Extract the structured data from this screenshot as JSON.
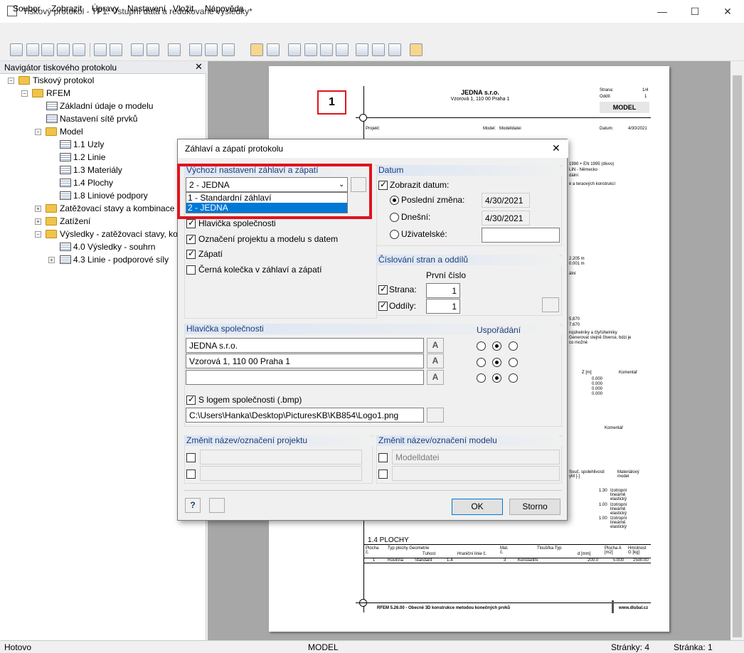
{
  "window": {
    "title": "Tiskový protokol - TP1: Vstupní data a redukované výsledky*"
  },
  "menu": [
    "Soubor",
    "Zobrazit",
    "Úpravy",
    "Nastavení",
    "Vložit",
    "Nápověda"
  ],
  "navigator": {
    "title": "Navigátor tiskového protokolu",
    "items": [
      "Tiskový protokol",
      "RFEM",
      "Základní údaje o modelu",
      "Nastavení sítě prvků",
      "Model",
      "1.1 Uzly",
      "1.2 Linie",
      "1.3 Materiály",
      "1.4 Plochy",
      "1.8 Liniové podpory",
      "Zatěžovací stavy a kombinace",
      "Zatížení",
      "Výsledky - zatěžovací stavy, kom",
      "4.0 Výsledky - souhrn",
      "4.3 Linie - podporové síly"
    ]
  },
  "page": {
    "number": "1",
    "company": "JEDNA s.r.o.",
    "address": "Vzorová 1, 110 00 Praha 1",
    "strana_label": "Strana:",
    "strana_val": "1/4",
    "oddil_label": "Oddíl:",
    "oddil_val": "1",
    "model_box": "MODEL",
    "projekt_label": "Projekt:",
    "model_label": "Model:",
    "model_val": "Modelldatei",
    "datum_label": "Datum:",
    "datum_val": "4/30/2021",
    "section": "1.4 PLOCHY",
    "footer_left": "RFEM 5.26.00 - Obecné 3D konstrukce metodou konečných prvků",
    "footer_right": "www.dlubal.cz",
    "snippets": [
      "1990 + EN 1995 (dlvvo)",
      "LIN - Německo",
      "dální",
      "é a teraových konstrukcí",
      "2.205 m",
      "0.001 m",
      "ální",
      "5.870",
      "7.670",
      "rojúhelníky a čtyřúhelníky",
      "Generovat stejně čtverce, bdzi je",
      "co možné",
      "Z [m]",
      "Komentář",
      "0.000",
      "0.000",
      "0.000",
      "0.000",
      "Komentář",
      "Souč. spolehlivosti γM [-]",
      "Materiálový model",
      "1.30",
      "Izotropní lineárně elastický",
      "1.00",
      "Izotropní lineárně elastický",
      "1.00",
      "Izotropní lineárně elastický"
    ],
    "table": {
      "h1": [
        "Plocha č.",
        "Typ plochy Geometrie",
        "Tuhost",
        "Hraniční linie č.",
        "Mat. č.",
        "Tloušťka Typ",
        "d [mm]",
        "Plocha A [m2]",
        "Hmotnost G [kg]"
      ],
      "row": [
        "1",
        "Rovinná",
        "Standard",
        "1-4",
        "3",
        "Konstantní",
        "200.0",
        "5.000",
        "2500.00"
      ]
    }
  },
  "dialog": {
    "title": "Záhlaví a zápatí protokolu",
    "default_group": "Výchozí nastavení záhlaví a zápatí",
    "combo_value": "2 - JEDNA",
    "options": [
      "1 - Standardní záhlaví",
      "2 - JEDNA"
    ],
    "checks": [
      "Hlavička společnosti",
      "Označení projektu a modelu s datem",
      "Zápatí",
      "Černá kolečka v záhlaví a zápatí"
    ],
    "datum": {
      "title": "Datum",
      "show": "Zobrazit datum:",
      "last": "Poslední změna:",
      "last_val": "4/30/2021",
      "today": "Dnešní:",
      "today_val": "4/30/2021",
      "user": "Uživatelské:"
    },
    "numbering": {
      "title": "Číslování stran a oddílů",
      "first": "První číslo",
      "strana": "Strana:",
      "strana_val": "1",
      "oddily": "Oddíly:",
      "oddily_val": "1"
    },
    "company": {
      "title": "Hlavička společnosti",
      "arrange": "Uspořádání",
      "line1": "JEDNA s.r.o.",
      "line2": "Vzorová 1, 110 00 Praha 1",
      "line3": "",
      "logo": "S logem společnosti (.bmp)",
      "logo_path": "C:\\Users\\Hanka\\Desktop\\PicturesKB\\KB854\\Logo1.png"
    },
    "project": {
      "title": "Změnit název/označení projektu"
    },
    "model": {
      "title": "Změnit název/označení modelu",
      "placeholder": "Modelldatei"
    },
    "ok": "OK",
    "cancel": "Storno"
  },
  "status": {
    "ready": "Hotovo",
    "model": "MODEL",
    "pages": "Stránky: 4",
    "page": "Stránka: 1"
  },
  "highlight_color": "#e0141e"
}
